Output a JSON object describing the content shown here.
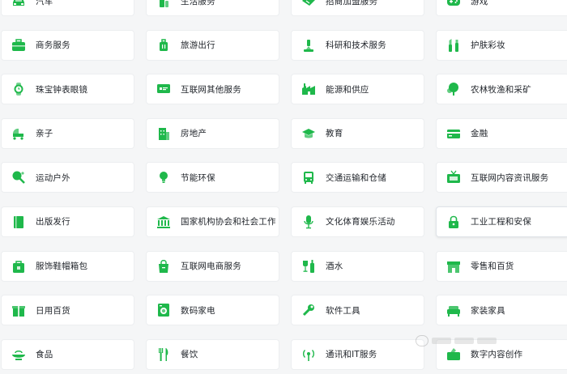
{
  "accent_color": "#1fb84b",
  "categories": [
    {
      "label": "汽车",
      "icon": "car-icon"
    },
    {
      "label": "生活服务",
      "icon": "bottle-icon"
    },
    {
      "label": "招商加盟服务",
      "icon": "handshake-icon"
    },
    {
      "label": "游戏",
      "icon": "gamepad-icon"
    },
    {
      "label": "商务服务",
      "icon": "briefcase-icon"
    },
    {
      "label": "旅游出行",
      "icon": "luggage-icon"
    },
    {
      "label": "科研和技术服务",
      "icon": "microscope-icon"
    },
    {
      "label": "护肤彩妆",
      "icon": "lipstick-icon"
    },
    {
      "label": "珠宝钟表眼镜",
      "icon": "watch-icon"
    },
    {
      "label": "互联网其他服务",
      "icon": "monitor-icon"
    },
    {
      "label": "能源和供应",
      "icon": "factory-icon"
    },
    {
      "label": "农林牧渔和采矿",
      "icon": "tree-icon"
    },
    {
      "label": "亲子",
      "icon": "stroller-icon"
    },
    {
      "label": "房地产",
      "icon": "building-icon"
    },
    {
      "label": "教育",
      "icon": "graduation-cap-icon"
    },
    {
      "label": "金融",
      "icon": "credit-card-icon"
    },
    {
      "label": "运动户外",
      "icon": "ping-pong-icon"
    },
    {
      "label": "节能环保",
      "icon": "lightbulb-icon"
    },
    {
      "label": "交通运输和仓储",
      "icon": "bus-icon"
    },
    {
      "label": "互联网内容资讯服务",
      "icon": "tv-icon"
    },
    {
      "label": "出版发行",
      "icon": "book-icon"
    },
    {
      "label": "国家机构协会和社会工作",
      "icon": "government-building-icon"
    },
    {
      "label": "文化体育娱乐活动",
      "icon": "microphone-icon"
    },
    {
      "label": "工业工程和安保",
      "icon": "lock-icon"
    },
    {
      "label": "服饰鞋帽箱包",
      "icon": "bag-icon"
    },
    {
      "label": "互联网电商服务",
      "icon": "shopping-bag-icon"
    },
    {
      "label": "酒水",
      "icon": "wine-icon"
    },
    {
      "label": "零售和百货",
      "icon": "store-icon"
    },
    {
      "label": "日用百货",
      "icon": "gift-icon"
    },
    {
      "label": "数码家电",
      "icon": "washing-machine-icon"
    },
    {
      "label": "软件工具",
      "icon": "wrench-icon"
    },
    {
      "label": "家装家具",
      "icon": "sofa-icon"
    },
    {
      "label": "食品",
      "icon": "food-bowl-icon"
    },
    {
      "label": "餐饮",
      "icon": "utensils-icon"
    },
    {
      "label": "通讯和IT服务",
      "icon": "antenna-icon"
    },
    {
      "label": "数字内容创作",
      "icon": "pen-tablet-icon"
    }
  ]
}
